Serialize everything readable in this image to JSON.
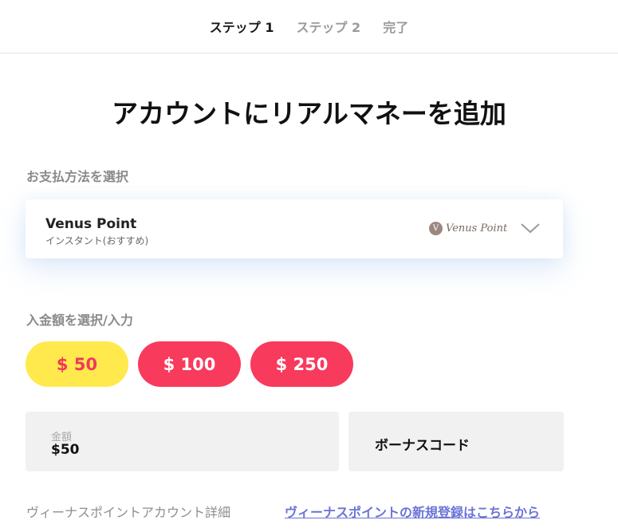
{
  "steps": {
    "step1": "ステップ 1",
    "step2": "ステップ 2",
    "done": "完了"
  },
  "title": "アカウントにリアルマネーを追加",
  "payment": {
    "section_label": "お支払方法を選択",
    "method_name": "Venus Point",
    "method_sub": "インスタント(おすすめ)",
    "logo_text": "Venus Point",
    "logo_mark": "V",
    "dropdown_icon": "chevron-down-icon"
  },
  "amount": {
    "section_label": "入金額を選択/入力",
    "options": [
      "$ 50",
      "$ 100",
      "$ 250"
    ],
    "selected_index": 0,
    "field_label": "金額",
    "field_value": "$50"
  },
  "bonus": {
    "label": "ボーナスコード"
  },
  "footer": {
    "account_details": "ヴィーナスポイントアカウント詳細",
    "register_link": "ヴィーナスポイントの新規登録はこちらから"
  },
  "colors": {
    "selected_pill_bg": "#ffe94d",
    "selected_pill_text": "#f0395a",
    "pill_bg": "#f83a5d",
    "link": "#6b73d6"
  }
}
